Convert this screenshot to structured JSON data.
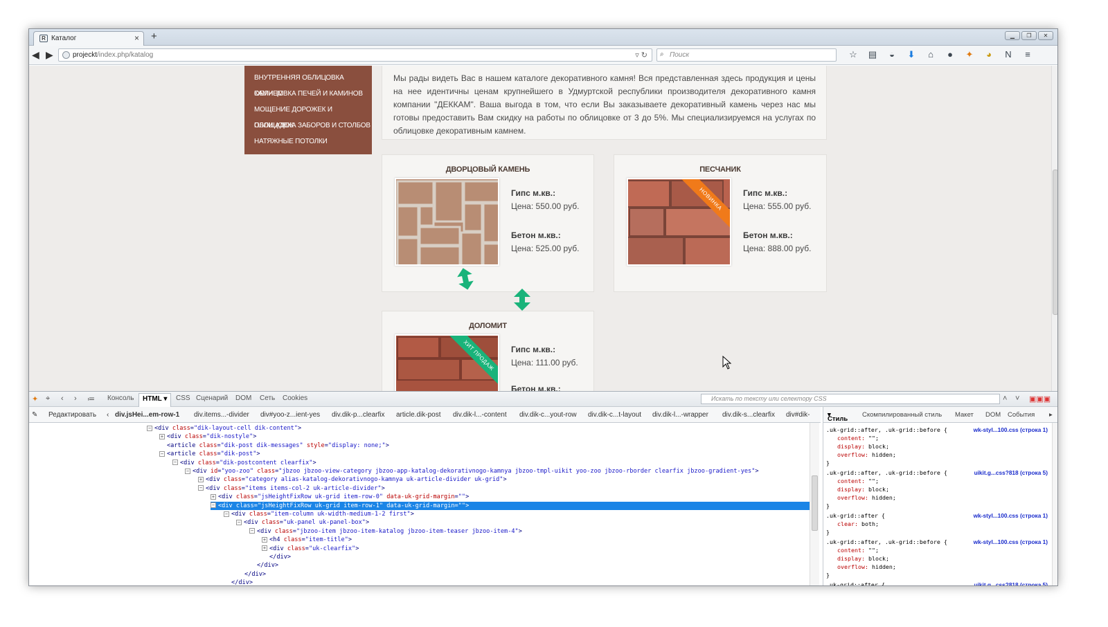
{
  "browser": {
    "tab_title": "Каталог",
    "tab_close": "×",
    "new_tab": "+",
    "url_main": "projeckt",
    "url_rest": "/index.php/katalog",
    "search_placeholder": "Поиск"
  },
  "page": {
    "menu": [
      "Внутренняя облицовка камнем",
      "Облицовка печей и каминов",
      "Мощение дорожек и площадок",
      "Облицовка заборов и столбов",
      "Натяжные потолки"
    ],
    "intro": "Мы рады видеть Вас в нашем каталоге декоративного камня! Вся представленная здесь продукция и цены на нее идентичны ценам крупнейшего в Удмуртской республики производителя декоративного камня компании \"ДЕККАМ\". Ваша выгода в том, что если Вы заказываете декоративный камень через нас мы готовы предоставить Вам скидку на работы по облицовке от 3 до 5%. Мы специализируемся на услугах по облицовке декоративным камнем.",
    "products": [
      {
        "title": "Дворцовый камень",
        "gips_label": "Гипс м.кв.:",
        "gips_price": "Цена: 550.00 руб.",
        "beton_label": "Бетон м.кв.:",
        "beton_price": "Цена: 525.00 руб."
      },
      {
        "title": "Песчаник",
        "ribbon": "НОВИНКА",
        "gips_label": "Гипс м.кв.:",
        "gips_price": "Цена: 555.00 руб.",
        "beton_label": "Бетон м.кв.:",
        "beton_price": "Цена: 888.00 руб."
      },
      {
        "title": "Доломит",
        "ribbon": "ХИТ ПРОДАЖ",
        "gips_label": "Гипс м.кв.:",
        "gips_price": "Цена: 111.00 руб.",
        "beton_label": "Бетон м.кв.:"
      }
    ],
    "accent_color": "#19b37a",
    "menu_color": "#8a4f3e"
  },
  "devtools": {
    "tabs": [
      "Консоль",
      "HTML",
      "CSS",
      "Сценарий",
      "DOM",
      "Сеть",
      "Cookies"
    ],
    "search_placeholder": "Искать по тексту или селектору CSS",
    "edit_label": "Редактировать",
    "breadcrumbs": [
      "div.jsHei...em-row-1",
      "div.items...-divider",
      "div#yoo-z...ient-yes",
      "div.dik-p...clearfix",
      "article.dik-post",
      "div.dik-l...-content",
      "div.dik-c...yout-row",
      "div.dik-c...t-layout",
      "div.dik-l...-wrapper",
      "div.dik-s...clearfix",
      "div#dik-"
    ],
    "side_tabs": [
      "Стиль",
      "Скомпилированный стиль",
      "Макет",
      "DOM",
      "События"
    ],
    "tree_lines": [
      {
        "pre": "<div",
        "attrs": [
          [
            "class",
            "dik-layout-cell dik-content"
          ]
        ],
        "post": ">"
      },
      {
        "pre": "<div",
        "attrs": [
          [
            "class",
            "dik-nostyle"
          ]
        ],
        "post": ">"
      },
      {
        "pre": "<article",
        "attrs": [
          [
            "class",
            "dik-post dik-messages"
          ],
          [
            "style",
            "display: none;"
          ]
        ],
        "post": ">"
      },
      {
        "pre": "<article",
        "attrs": [
          [
            "class",
            "dik-post"
          ]
        ],
        "post": ">"
      },
      {
        "pre": "<div",
        "attrs": [
          [
            "class",
            "dik-postcontent clearfix"
          ]
        ],
        "post": ">"
      },
      {
        "pre": "<div",
        "attrs": [
          [
            "id",
            "yoo-zoo"
          ],
          [
            "class",
            "jbzoo jbzoo-view-category jbzoo-app-katalog-dekorativnogo-kamnya jbzoo-tmpl-uikit yoo-zoo jbzoo-rborder clearfix jbzoo-gradient-yes"
          ]
        ],
        "post": ">"
      },
      {
        "pre": "<div",
        "attrs": [
          [
            "class",
            "category alias-katalog-dekorativnogo-kamnya uk-article-divider uk-grid"
          ]
        ],
        "post": ">"
      },
      {
        "pre": "<div",
        "attrs": [
          [
            "class",
            "items items-col-2 uk-article-divider"
          ]
        ],
        "post": ">"
      },
      {
        "pre": "<div",
        "attrs": [
          [
            "class",
            "jsHeightFixRow uk-grid item-row-0"
          ],
          [
            "data-uk-grid-margin",
            ""
          ]
        ],
        "post": ">"
      },
      {
        "pre": "<div",
        "attrs": [
          [
            "class",
            "jsHeightFixRow uk-grid item-row-1"
          ],
          [
            "data-uk-grid-margin",
            ""
          ]
        ],
        "post": ">"
      },
      {
        "pre": "<div",
        "attrs": [
          [
            "class",
            "item-column uk-width-medium-1-2 first"
          ]
        ],
        "post": ">"
      },
      {
        "pre": "<div",
        "attrs": [
          [
            "class",
            "uk-panel uk-panel-box"
          ]
        ],
        "post": ">"
      },
      {
        "pre": "<div",
        "attrs": [
          [
            "class",
            "jbzoo-item jbzoo-item-katalog jbzoo-item-teaser jbzoo-item-4"
          ]
        ],
        "post": ">"
      },
      {
        "pre": "<h4",
        "attrs": [
          [
            "class",
            "item-title"
          ]
        ],
        "post": ">"
      },
      {
        "pre": "<div",
        "attrs": [
          [
            "class",
            "uk-clearfix"
          ]
        ],
        "post": ">"
      },
      {
        "pre": "</div>",
        "attrs": [],
        "post": ""
      },
      {
        "pre": "</div>",
        "attrs": [],
        "post": ""
      },
      {
        "pre": "</div>",
        "attrs": [],
        "post": ""
      },
      {
        "pre": "</div>",
        "attrs": [],
        "post": ""
      }
    ],
    "css_rules": [
      {
        "selector": ".uk-grid::after, .uk-grid::before {",
        "source": "wk-styl...100.css (строка 1)",
        "props": [
          [
            "content",
            "\"\";"
          ],
          [
            "display",
            "block;"
          ],
          [
            "overflow",
            "hidden;"
          ]
        ]
      },
      {
        "selector": ".uk-grid::after, .uk-grid::before {",
        "source": "uikit.g...css?818 (строка 5)",
        "props": [
          [
            "content",
            "\"\";"
          ],
          [
            "display",
            "block;"
          ],
          [
            "overflow",
            "hidden;"
          ]
        ]
      },
      {
        "selector": ".uk-grid::after {",
        "source": "wk-styl...100.css (строка 1)",
        "props": [
          [
            "clear",
            "both;"
          ]
        ]
      },
      {
        "selector": ".uk-grid::after, .uk-grid::before {",
        "source": "wk-styl...100.css (строка 1)",
        "props": [
          [
            "content",
            "\"\";"
          ],
          [
            "display",
            "block;"
          ],
          [
            "overflow",
            "hidden;"
          ]
        ]
      },
      {
        "selector": ".uk-grid::after {",
        "source": "uikit.g...css?818 (строка 5)",
        "props": []
      }
    ]
  }
}
